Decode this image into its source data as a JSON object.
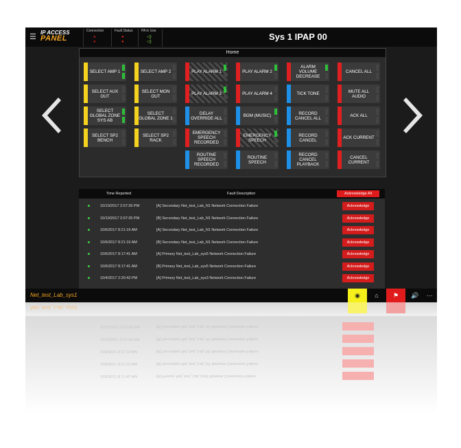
{
  "header": {
    "logo_line1": "IP ACCESS",
    "logo_line2": "PANEL",
    "connection_label": "Connection",
    "fault_status_label": "Fault Status",
    "pa_in_use_label": "PA in Use",
    "title": "Sys 1 IPAP 00"
  },
  "panel": {
    "title": "Home",
    "buttons": [
      {
        "label": "SELECT AMP 1",
        "stripe": "#f4d21f"
      },
      {
        "label": "SELECT AMP 2",
        "stripe": "#f4d21f"
      },
      {
        "label": "PLAY ALARM 1",
        "stripe": "#e02020",
        "hatched": true
      },
      {
        "label": "PLAY ALARM 2",
        "stripe": "#e02020"
      },
      {
        "label": "ALARM VOLUME DECREASE",
        "stripe": "#e02020"
      },
      {
        "label": "CANCEL ALL",
        "stripe": "#e02020"
      },
      {
        "label": "SELECT AUX OUT",
        "stripe": "#f4d21f"
      },
      {
        "label": "SELECT MON OUT",
        "stripe": "#f4d21f"
      },
      {
        "label": "PLAY ALARM 3",
        "stripe": "#e02020",
        "hatched": true
      },
      {
        "label": "PLAY ALARM 4",
        "stripe": "#e02020"
      },
      {
        "label": "TICK TONE",
        "stripe": "#1e90e8"
      },
      {
        "label": "MUTE ALL AUDIO",
        "stripe": "#e02020"
      },
      {
        "label": "SELECT GLOBAL ZONE SYS AB",
        "stripe": "#f4d21f"
      },
      {
        "label": "SELECT GLOBAL ZONE 1",
        "stripe": "#f4d21f"
      },
      {
        "label": "DELAY OVERRIDE ALL",
        "stripe": "#1e90e8"
      },
      {
        "label": "BGM (MUSIC)",
        "stripe": "#1e90e8"
      },
      {
        "label": "RECORD CANCEL ALL",
        "stripe": "#1e90e8"
      },
      {
        "label": "ACK ALL",
        "stripe": "#e02020"
      },
      {
        "label": "SELECT SP2 BENCH",
        "stripe": "#f4d21f"
      },
      {
        "label": "SELECT SP2 RACK",
        "stripe": "#f4d21f"
      },
      {
        "label": "EMERGENCY SPEECH RECORDED",
        "stripe": "#e02020"
      },
      {
        "label": "EMERGENCY SPEECH",
        "stripe": "#e02020",
        "hatched": true
      },
      {
        "label": "RECORD CANCEL",
        "stripe": "#1e90e8"
      },
      {
        "label": "ACK CURRENT",
        "stripe": "#e02020"
      },
      {
        "label": "ROUTINE SPEECH RECORDED",
        "stripe": "#1e90e8"
      },
      {
        "label": "ROUTINE SPEECH",
        "stripe": "#1e90e8"
      },
      {
        "label": "RECORD CANCEL PLAYBACK",
        "stripe": "#1e90e8"
      },
      {
        "label": "CANCEL CURRENT",
        "stripe": "#e02020"
      }
    ]
  },
  "faults": {
    "col_time": "Time Reported",
    "col_desc": "Fault Description",
    "ack_all_label": "Acknowledge All",
    "ack_label": "Acknowledge",
    "rows": [
      {
        "time": "10/10/2017 2:07:35 PM",
        "desc": "[A] Secondary Net_test_Lab_N1 Network Connection Failure"
      },
      {
        "time": "10/10/2017 2:07:35 PM",
        "desc": "[B] Secondary Net_test_Lab_N1 Network Connection Failure"
      },
      {
        "time": "10/6/2017 8:21:19 AM",
        "desc": "[A] Secondary Net_test_Lab_N1 Network Connection Failure"
      },
      {
        "time": "10/6/2017 8:21:19 AM",
        "desc": "[B] Secondary Net_test_Lab_N1 Network Connection Failure"
      },
      {
        "time": "10/6/2017 8:17:41 AM",
        "desc": "[A] Primary Net_test_Lab_sys5 Network Connection Failure"
      },
      {
        "time": "10/6/2017 8:17:41 AM",
        "desc": "[B] Primary Net_test_Lab_sys5 Network Connection Failure"
      },
      {
        "time": "10/4/2017 2:20:43 PM",
        "desc": "[A] Primary Net_test_Lab_sys3 Network Connection Failure"
      }
    ]
  },
  "footer": {
    "site_name": "Net_test_Lab_sys1",
    "more_label": "···"
  },
  "colors": {
    "accent_orange": "#f5a623",
    "alarm_red": "#e01b1b",
    "select_yellow": "#f4d21f",
    "info_blue": "#1e90e8",
    "status_green": "#3fd63f"
  }
}
